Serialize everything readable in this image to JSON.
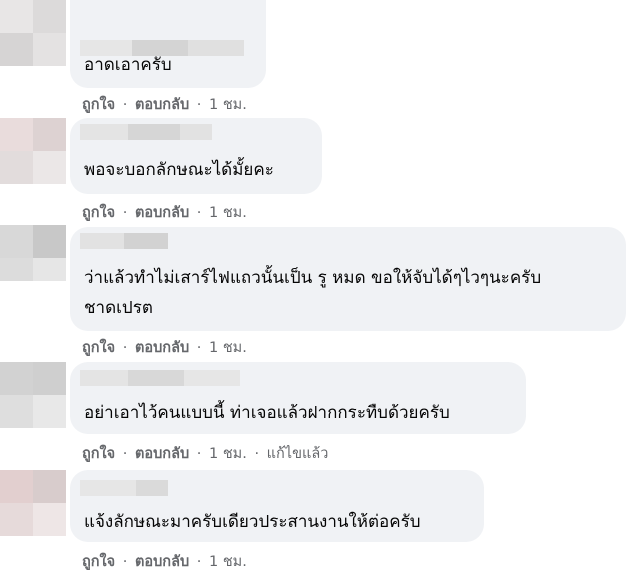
{
  "comments": [
    {
      "text_lines": [
        "อาดเอาครับ"
      ],
      "actions": {
        "like": "ถูกใจ",
        "reply": "ตอบกลับ",
        "time": "1 ชม.",
        "edited": ""
      }
    },
    {
      "text_lines": [
        "พอจะบอกลักษณะได้มั้ยคะ"
      ],
      "actions": {
        "like": "ถูกใจ",
        "reply": "ตอบกลับ",
        "time": "1 ชม.",
        "edited": ""
      }
    },
    {
      "text_lines": [
        "ว่าแล้วทำไม่เสาร์ไฟแถวนั้นเป็น รู หมด ขอให้จับได้ๆไวๆนะครับ",
        "ชาดเปรต"
      ],
      "actions": {
        "like": "ถูกใจ",
        "reply": "ตอบกลับ",
        "time": "1 ชม.",
        "edited": ""
      }
    },
    {
      "text_lines": [
        "อย่าเอาไว้คนแบบนี้ ท่าเจอแล้วฝากกระทืบด้วยครับ"
      ],
      "actions": {
        "like": "ถูกใจ",
        "reply": "ตอบกลับ",
        "time": "1 ชม.",
        "edited": "แก้ไขแล้ว"
      }
    },
    {
      "text_lines": [
        "แจ้งลักษณะมาครับเดียวประสานงานให้ต่อครับ"
      ],
      "actions": {
        "like": "ถูกใจ",
        "reply": "ตอบกลับ",
        "time": "1 ชม.",
        "edited": ""
      }
    }
  ],
  "colors": {
    "bubble": "#f0f2f5",
    "meta_text": "#65676b",
    "body_text": "#050505",
    "blur_light": "#e4e4e4",
    "blur_dark": "#cfcfcf"
  }
}
